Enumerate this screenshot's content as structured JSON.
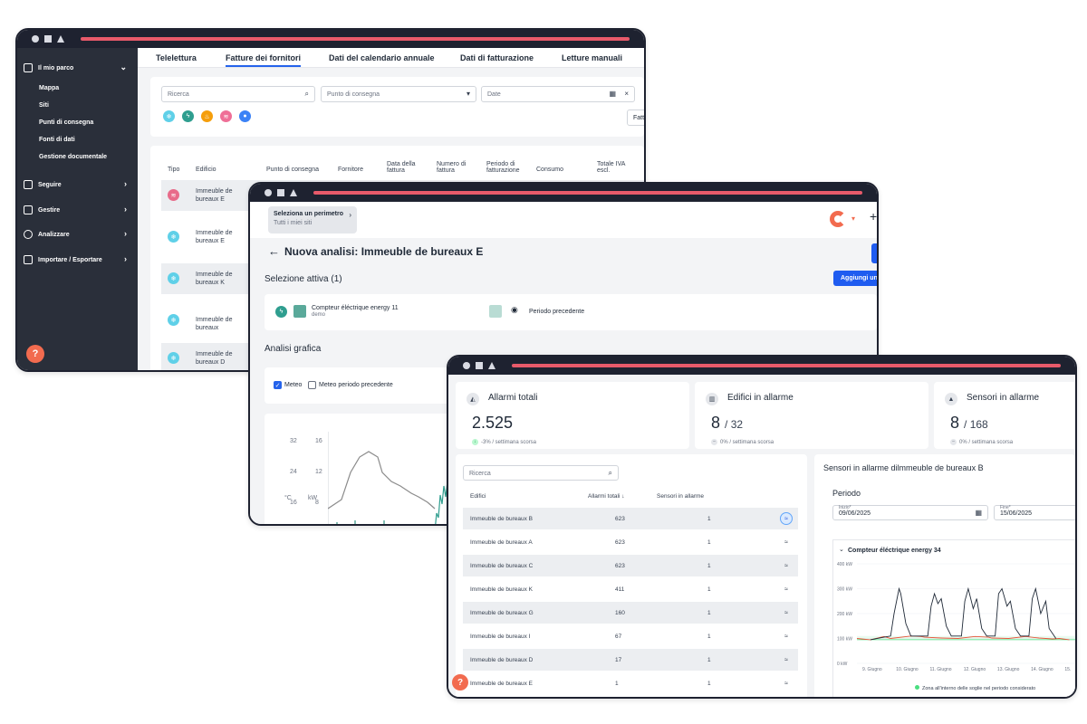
{
  "w1": {
    "sidebar": {
      "group": "Il mio parco",
      "subitems": [
        "Mappa",
        "Siti",
        "Punti di consegna",
        "Fonti di dati",
        "Gestione documentale"
      ],
      "items": [
        "Seguire",
        "Gestire",
        "Analizzare",
        "Importare / Esportare"
      ]
    },
    "help_label": "?",
    "tabs": [
      "Telelettura",
      "Fatture dei fornitori",
      "Dati del calendario annuale",
      "Dati di fatturazione",
      "Letture manuali"
    ],
    "filters": {
      "search_placeholder": "Ricerca",
      "delivery_placeholder": "Punto di consegna",
      "date_placeholder": "Date",
      "fat_button": "Fatt"
    },
    "columns": [
      "Tipo",
      "Edificio",
      "Punto di consegna",
      "Fornitore",
      "Data della fattura",
      "Numero di fattura",
      "Periodo di fatturazione",
      "Consumo",
      "Totale IVA escl."
    ],
    "rows": [
      {
        "building": "Immeuble de bureaux E",
        "type_color": "#e86b8a"
      },
      {
        "building": "Immeuble de bureaux E",
        "type_color": "#5fd0e8"
      },
      {
        "building": "Immeuble de bureaux K",
        "type_color": "#5fd0e8"
      },
      {
        "building": "Immeuble de bureaux",
        "type_color": "#5fd0e8"
      },
      {
        "building": "Immeuble de bureaux D",
        "type_color": "#5fd0e8"
      }
    ]
  },
  "w2": {
    "perimeter": {
      "title": "Seleziona un perimetro",
      "subtitle": "Tutti i miei siti"
    },
    "page_title": "Nuova analisi: Immeuble de bureaux E",
    "active_selection": "Selezione attiva (1)",
    "add_button": "Aggiungi un",
    "meter": {
      "name": "Compteur éléctrique energy 11",
      "sub": "demo"
    },
    "previous_period": "Periodo precedente",
    "graphic_analysis": "Analisi grafica",
    "weather": "Meteo",
    "weather_previous": "Meteo periodo precedente",
    "axis_left": {
      "ticks": [
        "32",
        "24",
        "16"
      ],
      "unit": "°C"
    },
    "axis_right": {
      "ticks": [
        "16",
        "12",
        "8"
      ],
      "unit": "kW"
    }
  },
  "w3": {
    "kpis": [
      {
        "label": "Allarmi totali",
        "value": "2.525",
        "denominator": "",
        "trend": "-3% / settimana scorsa",
        "trend_color": "#22c55e"
      },
      {
        "label": "Edifici in allarme",
        "value": "8",
        "denominator": "/ 32",
        "trend": "0% / settimana scorsa",
        "trend_color": "#9ca3af"
      },
      {
        "label": "Sensori in allarme",
        "value": "8",
        "denominator": "/ 168",
        "trend": "0% / settimana scorsa",
        "trend_color": "#9ca3af"
      }
    ],
    "search_placeholder": "Ricerca",
    "columns": {
      "buildings": "Edifici",
      "alarms": "Allarmi totali",
      "sensors": "Sensori in allarme"
    },
    "rows": [
      {
        "name": "Immeuble de bureaux B",
        "alarms": "623",
        "sensors": "1"
      },
      {
        "name": "Immeuble de bureaux A",
        "alarms": "623",
        "sensors": "1"
      },
      {
        "name": "Immeuble de bureaux C",
        "alarms": "623",
        "sensors": "1"
      },
      {
        "name": "Immeuble de bureaux K",
        "alarms": "411",
        "sensors": "1"
      },
      {
        "name": "Immeuble de bureaux G",
        "alarms": "160",
        "sensors": "1"
      },
      {
        "name": "Immeuble de bureaux I",
        "alarms": "67",
        "sensors": "1"
      },
      {
        "name": "Immeuble de bureaux D",
        "alarms": "17",
        "sensors": "1"
      },
      {
        "name": "Immeuble de bureaux E",
        "alarms": "1",
        "sensors": "1"
      }
    ],
    "detail_title": "Sensori in allarme dilmmeuble de bureaux B",
    "period_title": "Periodo",
    "start_label": "Inizio*",
    "start_value": "09/06/2025",
    "end_label": "Fine*",
    "end_value": "15/06/2025",
    "meter_title": "Compteur éléctrique energy 34",
    "legend": "Zona all'interno delle soglie nel periodo considerato",
    "help_label": "?"
  },
  "chart_data": {
    "type": "line",
    "title": "Compteur éléctrique energy 34",
    "x_ticks": [
      "9. Giugno",
      "10. Giugno",
      "11. Giugno",
      "12. Giugno",
      "13. Giugno",
      "14. Giugno",
      "15."
    ],
    "y_ticks": [
      "0 kW",
      "100 kW",
      "200 kW",
      "300 kW",
      "400 kW"
    ],
    "ylim": [
      0,
      400
    ],
    "series": [
      {
        "color": "#e8553c",
        "points": [
          [
            0,
            100
          ],
          [
            0.4,
            95
          ],
          [
            0.8,
            108
          ],
          [
            1.0,
            100
          ],
          [
            1.6,
            110
          ],
          [
            1.9,
            108
          ],
          [
            2.0,
            105
          ],
          [
            2.5,
            102
          ],
          [
            3.0,
            100
          ],
          [
            3.5,
            108
          ],
          [
            3.9,
            105
          ],
          [
            4.0,
            102
          ],
          [
            4.5,
            100
          ],
          [
            5.0,
            108
          ],
          [
            5.4,
            102
          ],
          [
            5.8,
            98
          ],
          [
            6.0,
            100
          ],
          [
            6.3,
            95
          ]
        ]
      },
      {
        "color": "#1f2937",
        "points": [
          [
            0.4,
            95
          ],
          [
            0.8,
            105
          ],
          [
            1.0,
            110
          ],
          [
            1.1,
            200
          ],
          [
            1.25,
            300
          ],
          [
            1.3,
            280
          ],
          [
            1.45,
            160
          ],
          [
            1.6,
            110
          ],
          [
            2.1,
            110
          ],
          [
            2.2,
            230
          ],
          [
            2.3,
            280
          ],
          [
            2.4,
            240
          ],
          [
            2.5,
            260
          ],
          [
            2.65,
            150
          ],
          [
            2.8,
            110
          ],
          [
            3.1,
            110
          ],
          [
            3.2,
            250
          ],
          [
            3.3,
            300
          ],
          [
            3.45,
            220
          ],
          [
            3.55,
            260
          ],
          [
            3.7,
            140
          ],
          [
            3.85,
            110
          ],
          [
            4.1,
            110
          ],
          [
            4.2,
            280
          ],
          [
            4.3,
            300
          ],
          [
            4.45,
            230
          ],
          [
            4.55,
            250
          ],
          [
            4.7,
            140
          ],
          [
            4.85,
            110
          ],
          [
            5.1,
            110
          ],
          [
            5.2,
            260
          ],
          [
            5.3,
            300
          ],
          [
            5.45,
            200
          ],
          [
            5.6,
            250
          ],
          [
            5.7,
            140
          ],
          [
            5.9,
            100
          ]
        ]
      }
    ],
    "threshold_band": [
      95,
      110
    ],
    "band_color": "#4ade80",
    "xlim": [
      0,
      6.5
    ]
  },
  "colors": {
    "accent_red": "#e85a6a",
    "brand_blue": "#1f5cf0",
    "sidebar_bg": "#2a2f3a"
  }
}
